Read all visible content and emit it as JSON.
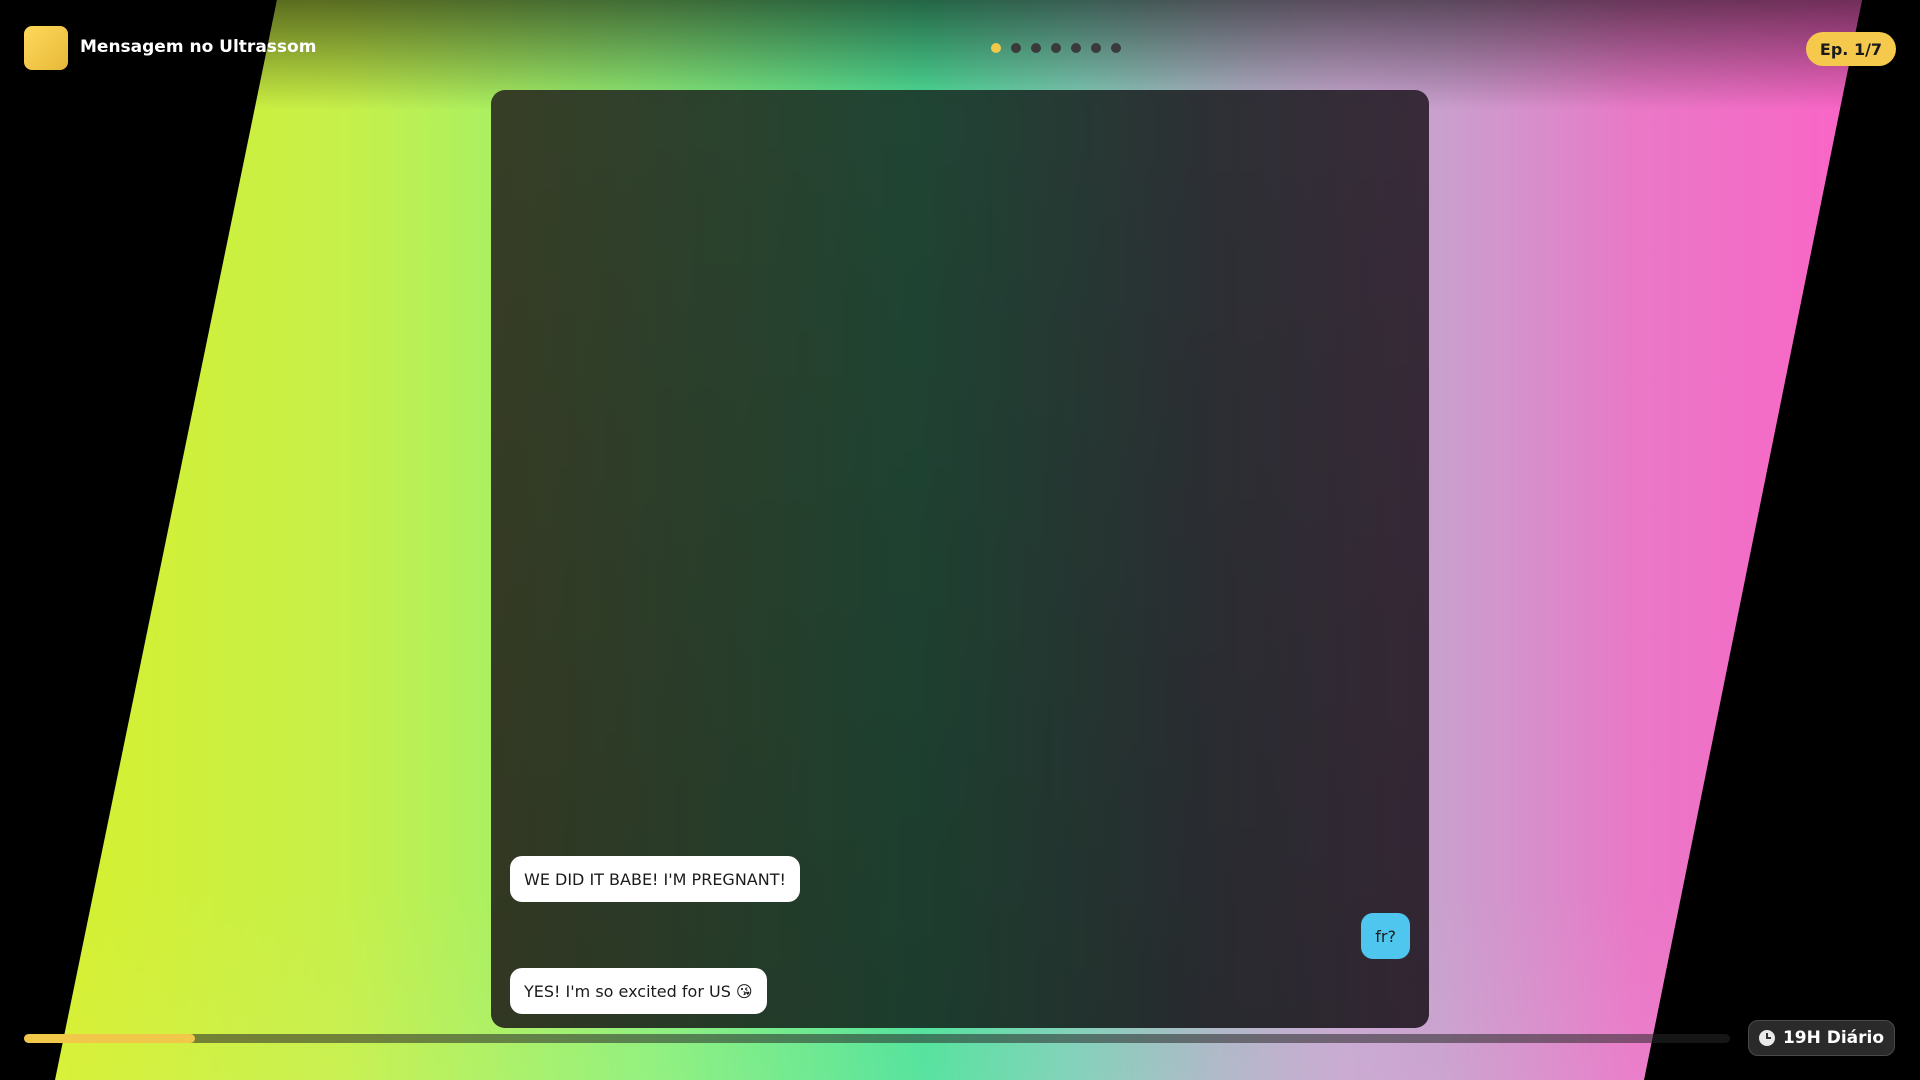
{
  "header": {
    "title": "Mensagem no Ultrassom",
    "episode_badge": "Ep. 1/7",
    "pagination": {
      "total": 7,
      "active_index": 0
    }
  },
  "chat": {
    "messages": [
      {
        "side": "left",
        "text": "WE DID IT BABE! I'M PREGNANT!"
      },
      {
        "side": "right",
        "text": "fr?"
      },
      {
        "side": "left",
        "text": "YES! I'm so excited for US 😘"
      }
    ]
  },
  "footer": {
    "progress_fraction": 0.1,
    "schedule_label": "19H Diário",
    "schedule_icon": "clock-icon"
  },
  "colors": {
    "accent": "#f2c84b",
    "bubble_left": "#ffffff",
    "bubble_right": "#4fc6ee"
  }
}
